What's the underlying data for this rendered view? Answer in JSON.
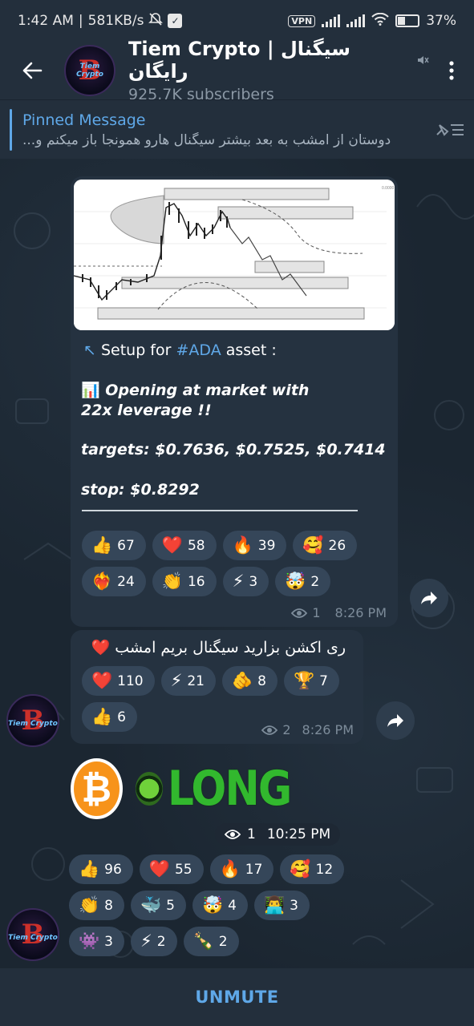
{
  "status_bar": {
    "time": "1:42 AM",
    "speed": "581KB/s",
    "vpn": "VPN",
    "battery": "37%",
    "battery_level": 0.37
  },
  "header": {
    "title": "Tiem Crypto | سیگنال رایگان",
    "subtitle": "925.7K subscribers",
    "avatar_text": "Tiem Crypto",
    "avatar_glyph": "B"
  },
  "pinned": {
    "title": "Pinned Message",
    "text": "دوستان از امشب به بعد بیشتر سیگنال هارو همونجا باز میکنم و..."
  },
  "message1": {
    "setup_prefix": "Setup for ",
    "hashtag": "#ADA",
    "setup_suffix": " asset :",
    "line1": "Opening at market with 22x leverage !!",
    "targets": "targets: $0.7636, $0.7525, $0.7414",
    "stop": "stop: $0.8292",
    "reactions": [
      {
        "emoji": "👍",
        "count": "67"
      },
      {
        "emoji": "❤️",
        "count": "58"
      },
      {
        "emoji": "🔥",
        "count": "39"
      },
      {
        "emoji": "🥰",
        "count": "26"
      },
      {
        "emoji": "❤️‍🔥",
        "count": "24"
      },
      {
        "emoji": "👏",
        "count": "16"
      },
      {
        "emoji": "⚡",
        "count": "3"
      },
      {
        "emoji": "🤯",
        "count": "2"
      }
    ],
    "views": "1",
    "time": "8:26 PM"
  },
  "message2": {
    "text": "ری اکشن بزارید سیگنال بریم امشب ❤️",
    "reactions": [
      {
        "emoji": "❤️",
        "count": "110"
      },
      {
        "emoji": "⚡",
        "count": "21"
      },
      {
        "emoji": "🫵",
        "count": "8"
      },
      {
        "emoji": "🏆",
        "count": "7"
      },
      {
        "emoji": "👍",
        "count": "6"
      }
    ],
    "views": "2",
    "time": "8:26 PM"
  },
  "message3": {
    "btc_symbol": "₿",
    "long_label": "LONG",
    "views": "1",
    "time": "10:25 PM",
    "reactions": [
      {
        "emoji": "👍",
        "count": "96"
      },
      {
        "emoji": "❤️",
        "count": "55"
      },
      {
        "emoji": "🔥",
        "count": "17"
      },
      {
        "emoji": "🥰",
        "count": "12"
      },
      {
        "emoji": "👏",
        "count": "8"
      },
      {
        "emoji": "🐳",
        "count": "5"
      },
      {
        "emoji": "🤯",
        "count": "4"
      },
      {
        "emoji": "👨‍💻",
        "count": "3"
      },
      {
        "emoji": "👾",
        "count": "3"
      },
      {
        "emoji": "⚡",
        "count": "2"
      },
      {
        "emoji": "🍾",
        "count": "2"
      }
    ]
  },
  "bottom": {
    "unmute_label": "UNMUTE"
  },
  "colors": {
    "accent": "#5fa8e8",
    "bubble": "#253240",
    "header": "#232f3c",
    "long_green": "#32b82e",
    "btc_orange": "#f7931a"
  }
}
